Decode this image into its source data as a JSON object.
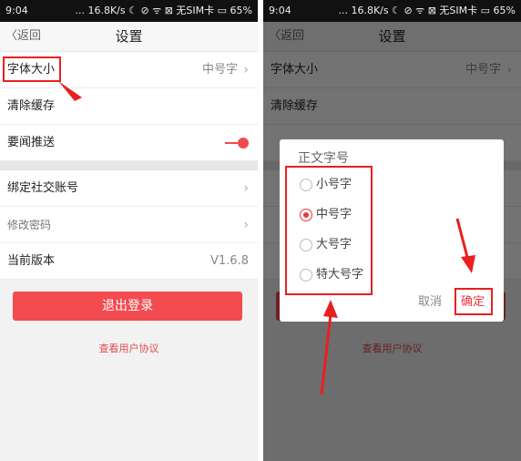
{
  "status": {
    "time": "9:04",
    "right": "... 16.8K/s ☾ ⊘ ᯤ ⊠ 无SIM卡 ▭ 65%"
  },
  "header": {
    "back": "返回",
    "title": "设置"
  },
  "settings": {
    "font_size_label": "字体大小",
    "font_size_value": "中号字",
    "clear_cache": "清除缓存",
    "news_push": "要闻推送",
    "bind_social": "绑定社交账号",
    "change_password": "修改密码",
    "version_label": "当前版本",
    "version_value": "V1.6.8"
  },
  "logout": "退出登录",
  "user_agreement": "查看用户协议",
  "dialog": {
    "title": "正文字号",
    "options": [
      "小号字",
      "中号字",
      "大号字",
      "特大号字"
    ],
    "selected": "中号字",
    "cancel": "取消",
    "confirm": "确定"
  },
  "colors": {
    "accent": "#f24b50",
    "highlight": "#e8201f"
  }
}
